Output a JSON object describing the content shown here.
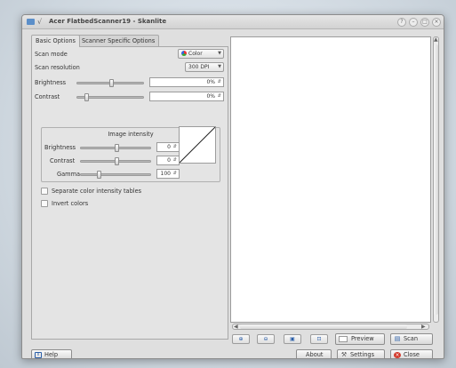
{
  "window": {
    "title": "Acer FlatbedScanner19 - Skanlite"
  },
  "tabs": [
    {
      "label": "Basic Options"
    },
    {
      "label": "Scanner Specific Options"
    }
  ],
  "basic": {
    "scan_mode_label": "Scan mode",
    "scan_mode_value": "Color",
    "resolution_label": "Scan resolution",
    "resolution_value": "300 DPI",
    "brightness_label": "Brightness",
    "brightness_value": "0%",
    "contrast_label": "Contrast",
    "contrast_value": "0%"
  },
  "intensity": {
    "title": "Image intensity",
    "brightness_label": "Brightness",
    "brightness_value": "0",
    "contrast_label": "Contrast",
    "contrast_value": "0",
    "gamma_label": "Gamma",
    "gamma_value": "100"
  },
  "checks": {
    "separate_label": "Separate color intensity tables",
    "invert_label": "Invert colors"
  },
  "buttons": {
    "help": "Help",
    "about": "About",
    "settings": "Settings",
    "close": "Close",
    "preview": "Preview",
    "scan": "Scan"
  },
  "icons": {
    "window": "scanner-icon",
    "pin": "pin-icon",
    "help": "help-icon",
    "settings": "settings-icon",
    "close": "close-icon",
    "preview": "preview-icon",
    "scan": "scan-icon",
    "zoom_in": "zoom-in-icon",
    "zoom_out": "zoom-out-icon",
    "select": "select-icon",
    "zoom_fit": "zoom-fit-icon"
  },
  "colors": {
    "accent": "#2a5ea8",
    "close_icon": "#d33a2c"
  }
}
